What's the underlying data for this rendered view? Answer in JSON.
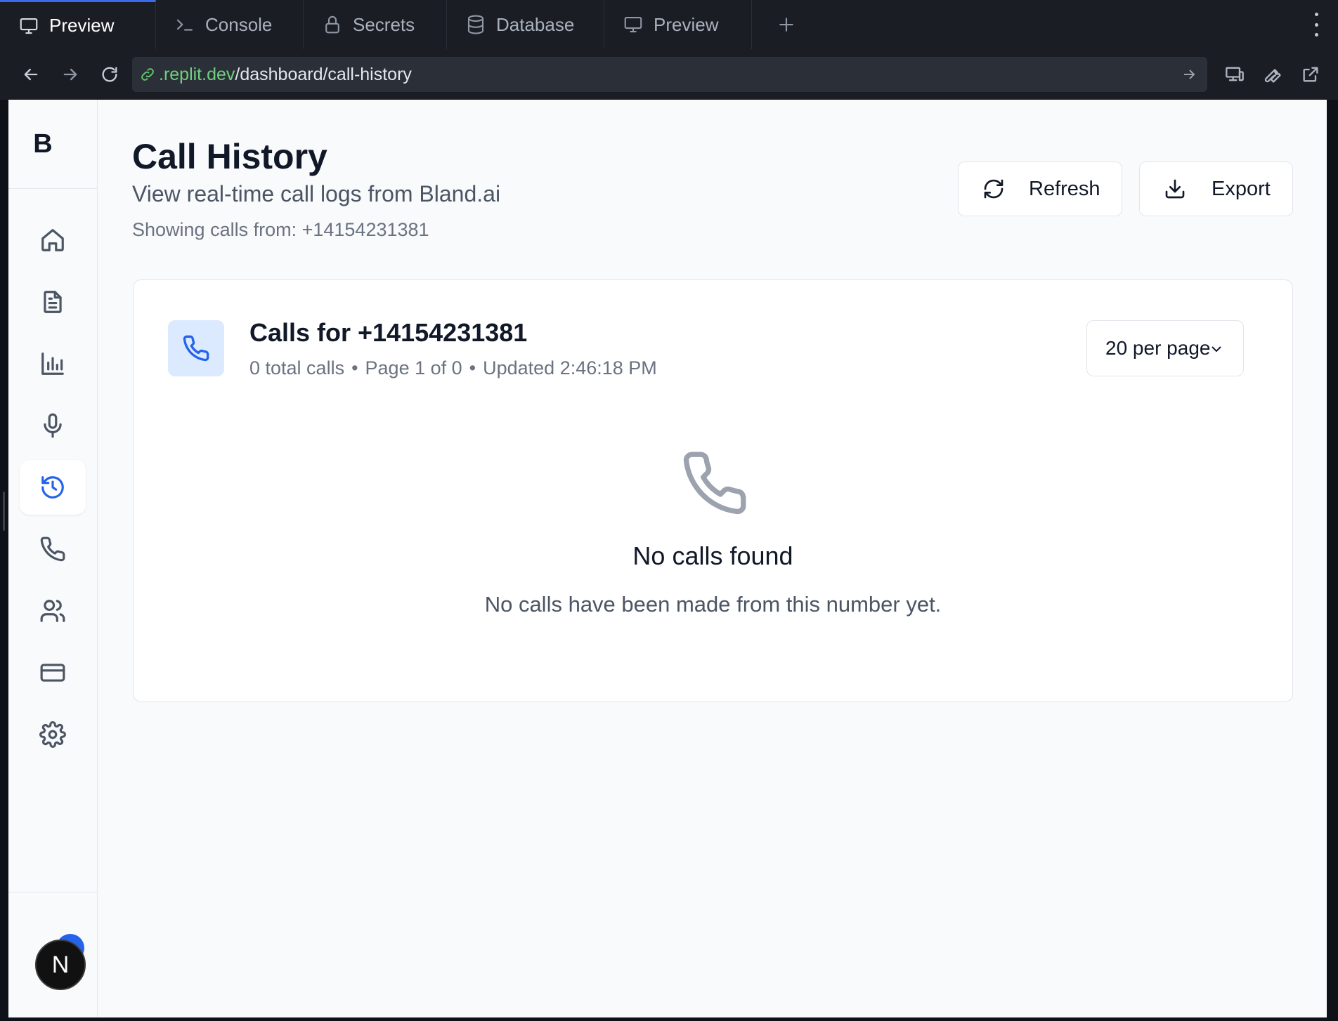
{
  "ide_tabs": [
    {
      "label": "Preview",
      "icon": "monitor-icon",
      "active": true
    },
    {
      "label": "Console",
      "icon": "terminal-icon",
      "active": false
    },
    {
      "label": "Secrets",
      "icon": "lock-icon",
      "active": false
    },
    {
      "label": "Database",
      "icon": "database-icon",
      "active": false
    },
    {
      "label": "Preview",
      "icon": "monitor-icon",
      "active": false
    }
  ],
  "url": {
    "host": ".replit.dev",
    "path": "/dashboard/call-history"
  },
  "brand": {
    "logo_letter": "B"
  },
  "sidebar": {
    "items": [
      {
        "name": "home",
        "icon": "home-icon"
      },
      {
        "name": "documents",
        "icon": "file-text-icon"
      },
      {
        "name": "analytics",
        "icon": "bar-chart-icon"
      },
      {
        "name": "voice",
        "icon": "microphone-icon"
      },
      {
        "name": "call-history",
        "icon": "history-icon",
        "active": true
      },
      {
        "name": "calls",
        "icon": "phone-icon"
      },
      {
        "name": "contacts",
        "icon": "users-icon"
      },
      {
        "name": "billing",
        "icon": "credit-card-icon"
      },
      {
        "name": "settings",
        "icon": "gear-icon"
      }
    ],
    "avatar_letter": "N"
  },
  "header": {
    "title": "Call History",
    "subtitle": "View real-time call logs from Bland.ai",
    "meta": "Showing calls from: +14154231381",
    "refresh_label": "Refresh",
    "export_label": "Export"
  },
  "card": {
    "title": "Calls for +14154231381",
    "total_calls": "0 total calls",
    "page_info": "Page 1 of 0",
    "updated": "Updated 2:46:18 PM",
    "separator": "•",
    "per_page": "20 per page",
    "empty_title": "No calls found",
    "empty_desc": "No calls have been made from this number yet."
  },
  "colors": {
    "accent": "#2563eb",
    "url_host": "#6fd07c",
    "ide_bg": "#1a1d24"
  }
}
